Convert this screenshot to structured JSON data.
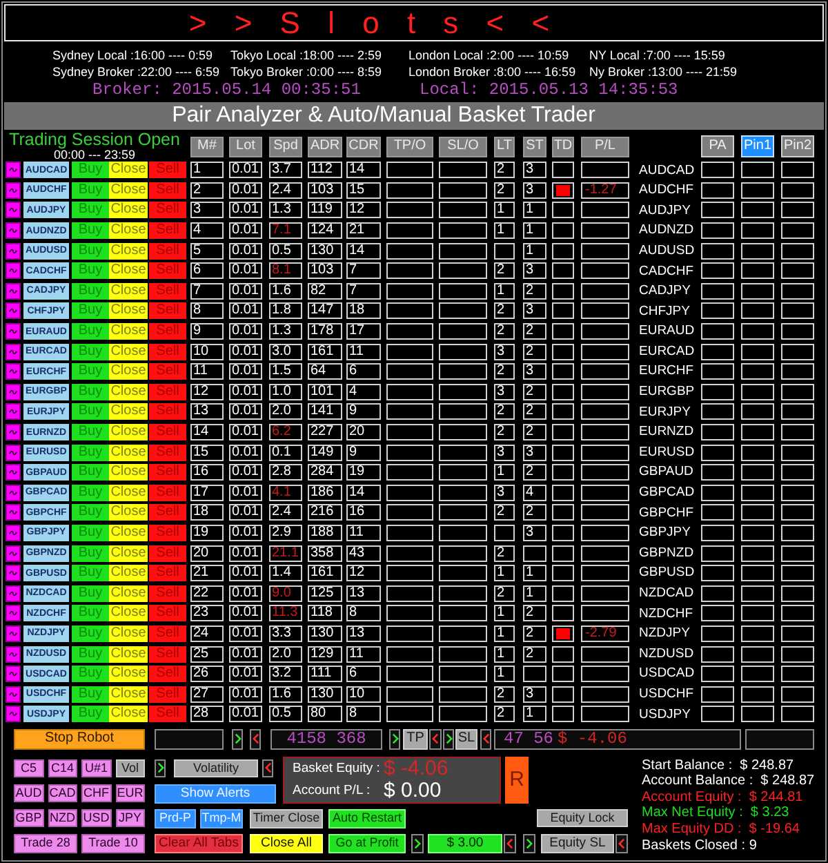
{
  "title": "> > S l o t s < <",
  "sessions": [
    {
      "local": "Sydney Local :16:00 ---- 0:59",
      "broker": "Sydney Broker :22:00 ---- 6:59"
    },
    {
      "local": "Tokyo Local :18:00 ---- 2:59",
      "broker": "Tokyo Broker :0:00 ---- 8:59"
    },
    {
      "local": "London Local :2:00 ---- 10:59",
      "broker": "London Broker :8:00 ---- 16:59"
    },
    {
      "local": "NY Local :7:00 ---- 15:59",
      "broker": "Ny Broker :13:00 ---- 21:59"
    }
  ],
  "clocks": {
    "broker": "Broker: 2015.05.14 00:35:51",
    "local": "Local: 2015.05.13 14:35:53"
  },
  "panel_title": "Pair Analyzer & Auto/Manual Basket Trader",
  "session_status": {
    "label": "Trading Session Open",
    "hours": "00:00 --- 23:59"
  },
  "table": {
    "columns": [
      "M#",
      "Lot",
      "Spd",
      "ADR",
      "CDR",
      "TP/O",
      "SL/O",
      "LT",
      "ST",
      "TD",
      "P/L"
    ],
    "pins": [
      {
        "label": "PA",
        "selected": false
      },
      {
        "label": "Pin1",
        "selected": true
      },
      {
        "label": "Pin2",
        "selected": false
      }
    ],
    "rows": [
      {
        "pair": "AUDCAD",
        "buy": "Buy",
        "close": "Close",
        "sell": "Sell",
        "num": "1",
        "lot": "0.01",
        "spread": "3.7",
        "spread_high": false,
        "adr": "112",
        "cdr": "14",
        "lt": "2",
        "st": "3",
        "trade_open": false,
        "name": "AUDCAD"
      },
      {
        "pair": "AUDCHF",
        "buy": "Buy",
        "close": "Close",
        "sell": "Sell",
        "num": "2",
        "lot": "0.01",
        "spread": "2.4",
        "spread_high": false,
        "adr": "103",
        "cdr": "15",
        "lt": "2",
        "st": "3",
        "trade_open": true,
        "pl": "-1.27",
        "name": "AUDCHF"
      },
      {
        "pair": "AUDJPY",
        "buy": "Buy",
        "close": "Close",
        "sell": "Sell",
        "num": "3",
        "lot": "0.01",
        "spread": "1.3",
        "spread_high": false,
        "adr": "119",
        "cdr": "12",
        "lt": "1",
        "st": "1",
        "trade_open": false,
        "name": "AUDJPY"
      },
      {
        "pair": "AUDNZD",
        "buy": "Buy",
        "close": "Close",
        "sell": "Sell",
        "num": "4",
        "lot": "0.01",
        "spread": "7.1",
        "spread_high": true,
        "adr": "124",
        "cdr": "21",
        "lt": "1",
        "st": "1",
        "trade_open": false,
        "name": "AUDNZD"
      },
      {
        "pair": "AUDUSD",
        "buy": "Buy",
        "close": "Close",
        "sell": "Sell",
        "num": "5",
        "lot": "0.01",
        "spread": "0.5",
        "spread_high": false,
        "adr": "130",
        "cdr": "14",
        "st": "1",
        "trade_open": false,
        "name": "AUDUSD"
      },
      {
        "pair": "CADCHF",
        "buy": "Buy",
        "close": "Close",
        "sell": "Sell",
        "num": "6",
        "lot": "0.01",
        "spread": "8.1",
        "spread_high": true,
        "adr": "103",
        "cdr": "7",
        "lt": "2",
        "st": "3",
        "trade_open": false,
        "name": "CADCHF"
      },
      {
        "pair": "CADJPY",
        "buy": "Buy",
        "close": "Close",
        "sell": "Sell",
        "num": "7",
        "lot": "0.01",
        "spread": "1.6",
        "spread_high": false,
        "adr": "82",
        "cdr": "7",
        "lt": "1",
        "st": "2",
        "trade_open": false,
        "name": "CADJPY"
      },
      {
        "pair": "CHFJPY",
        "buy": "Buy",
        "close": "Close",
        "sell": "Sell",
        "num": "8",
        "lot": "0.01",
        "spread": "1.8",
        "spread_high": false,
        "adr": "147",
        "cdr": "18",
        "lt": "2",
        "st": "3",
        "trade_open": false,
        "name": "CHFJPY"
      },
      {
        "pair": "EURAUD",
        "buy": "Buy",
        "close": "Close",
        "sell": "Sell",
        "num": "9",
        "lot": "0.01",
        "spread": "1.3",
        "spread_high": false,
        "adr": "178",
        "cdr": "17",
        "lt": "2",
        "st": "2",
        "trade_open": false,
        "name": "EURAUD"
      },
      {
        "pair": "EURCAD",
        "buy": "Buy",
        "close": "Close",
        "sell": "Sell",
        "num": "10",
        "lot": "0.01",
        "spread": "3.0",
        "spread_high": false,
        "adr": "161",
        "cdr": "11",
        "lt": "3",
        "st": "2",
        "trade_open": false,
        "name": "EURCAD"
      },
      {
        "pair": "EURCHF",
        "buy": "Buy",
        "close": "Close",
        "sell": "Sell",
        "num": "11",
        "lot": "0.01",
        "spread": "1.5",
        "spread_high": false,
        "adr": "64",
        "cdr": "6",
        "lt": "2",
        "st": "3",
        "trade_open": false,
        "name": "EURCHF"
      },
      {
        "pair": "EURGBP",
        "buy": "Buy",
        "close": "Close",
        "sell": "Sell",
        "num": "12",
        "lot": "0.01",
        "spread": "1.0",
        "spread_high": false,
        "adr": "101",
        "cdr": "4",
        "lt": "3",
        "st": "2",
        "trade_open": false,
        "name": "EURGBP"
      },
      {
        "pair": "EURJPY",
        "buy": "Buy",
        "close": "Close",
        "sell": "Sell",
        "num": "13",
        "lot": "0.01",
        "spread": "2.0",
        "spread_high": false,
        "adr": "141",
        "cdr": "9",
        "lt": "2",
        "st": "2",
        "trade_open": false,
        "name": "EURJPY"
      },
      {
        "pair": "EURNZD",
        "buy": "Buy",
        "close": "Close",
        "sell": "Sell",
        "num": "14",
        "lot": "0.01",
        "spread": "6.2",
        "spread_high": true,
        "adr": "227",
        "cdr": "20",
        "lt": "2",
        "st": "2",
        "trade_open": false,
        "name": "EURNZD"
      },
      {
        "pair": "EURUSD",
        "buy": "Buy",
        "close": "Close",
        "sell": "Sell",
        "num": "15",
        "lot": "0.01",
        "spread": "0.1",
        "spread_high": false,
        "adr": "149",
        "cdr": "9",
        "lt": "3",
        "st": "3",
        "trade_open": false,
        "name": "EURUSD"
      },
      {
        "pair": "GBPAUD",
        "buy": "Buy",
        "close": "Close",
        "sell": "Sell",
        "num": "16",
        "lot": "0.01",
        "spread": "2.8",
        "spread_high": false,
        "adr": "284",
        "cdr": "19",
        "lt": "1",
        "st": "2",
        "trade_open": false,
        "name": "GBPAUD"
      },
      {
        "pair": "GBPCAD",
        "buy": "Buy",
        "close": "Close",
        "sell": "Sell",
        "num": "17",
        "lot": "0.01",
        "spread": "4.1",
        "spread_high": true,
        "adr": "186",
        "cdr": "14",
        "lt": "3",
        "st": "4",
        "trade_open": false,
        "name": "GBPCAD"
      },
      {
        "pair": "GBPCHF",
        "buy": "Buy",
        "close": "Close",
        "sell": "Sell",
        "num": "18",
        "lot": "0.01",
        "spread": "2.4",
        "spread_high": false,
        "adr": "216",
        "cdr": "16",
        "lt": "2",
        "st": "2",
        "trade_open": false,
        "name": "GBPCHF"
      },
      {
        "pair": "GBPJPY",
        "buy": "Buy",
        "close": "Close",
        "sell": "Sell",
        "num": "19",
        "lot": "0.01",
        "spread": "2.9",
        "spread_high": false,
        "adr": "188",
        "cdr": "11",
        "st": "3",
        "trade_open": false,
        "name": "GBPJPY"
      },
      {
        "pair": "GBPNZD",
        "buy": "Buy",
        "close": "Close",
        "sell": "Sell",
        "num": "20",
        "lot": "0.01",
        "spread": "21.1",
        "spread_high": true,
        "adr": "358",
        "cdr": "43",
        "lt": "2",
        "trade_open": false,
        "name": "GBPNZD"
      },
      {
        "pair": "GBPUSD",
        "buy": "Buy",
        "close": "Close",
        "sell": "Sell",
        "num": "21",
        "lot": "0.01",
        "spread": "1.4",
        "spread_high": false,
        "adr": "161",
        "cdr": "12",
        "lt": "1",
        "st": "1",
        "trade_open": false,
        "name": "GBPUSD"
      },
      {
        "pair": "NZDCAD",
        "buy": "Buy",
        "close": "Close",
        "sell": "Sell",
        "num": "22",
        "lot": "0.01",
        "spread": "9.0",
        "spread_high": true,
        "adr": "125",
        "cdr": "13",
        "lt": "2",
        "st": "1",
        "trade_open": false,
        "name": "NZDCAD"
      },
      {
        "pair": "NZDCHF",
        "buy": "Buy",
        "close": "Close",
        "sell": "Sell",
        "num": "23",
        "lot": "0.01",
        "spread": "11.3",
        "spread_high": true,
        "adr": "118",
        "cdr": "8",
        "lt": "1",
        "st": "2",
        "trade_open": false,
        "name": "NZDCHF"
      },
      {
        "pair": "NZDJPY",
        "buy": "Buy",
        "close": "Close",
        "sell": "Sell",
        "num": "24",
        "lot": "0.01",
        "spread": "3.3",
        "spread_high": false,
        "adr": "130",
        "cdr": "13",
        "lt": "1",
        "st": "2",
        "trade_open": true,
        "pl": "-2.79",
        "name": "NZDJPY"
      },
      {
        "pair": "NZDUSD",
        "buy": "Buy",
        "close": "Close",
        "sell": "Sell",
        "num": "25",
        "lot": "0.01",
        "spread": "2.0",
        "spread_high": false,
        "adr": "129",
        "cdr": "11",
        "lt": "1",
        "st": "2",
        "trade_open": false,
        "name": "NZDUSD"
      },
      {
        "pair": "USDCAD",
        "buy": "Buy",
        "close": "Close",
        "sell": "Sell",
        "num": "26",
        "lot": "0.01",
        "spread": "3.2",
        "spread_high": false,
        "adr": "111",
        "cdr": "6",
        "lt": "1",
        "trade_open": false,
        "name": "USDCAD"
      },
      {
        "pair": "USDCHF",
        "buy": "Buy",
        "close": "Close",
        "sell": "Sell",
        "num": "27",
        "lot": "0.01",
        "spread": "1.6",
        "spread_high": false,
        "adr": "130",
        "cdr": "10",
        "lt": "2",
        "st": "3",
        "trade_open": false,
        "name": "USDCHF"
      },
      {
        "pair": "USDJPY",
        "buy": "Buy",
        "close": "Close",
        "sell": "Sell",
        "num": "28",
        "lot": "0.01",
        "spread": "0.5",
        "spread_high": false,
        "adr": "80",
        "cdr": "8",
        "lt": "2",
        "st": "1",
        "trade_open": false,
        "name": "USDJPY"
      }
    ]
  },
  "controls": {
    "stop_robot": "Stop Robot",
    "counter": "4158 368",
    "tp": "TP",
    "sl": "SL",
    "readout": {
      "pips": "47 56",
      "amount": "$ -4.06"
    }
  },
  "filters": [
    {
      "label": "C5",
      "on": true
    },
    {
      "label": "C14",
      "on": true
    },
    {
      "label": "U#1",
      "on": true
    },
    {
      "label": "Vol",
      "on": false
    },
    {
      "label": "AUD",
      "on": true
    },
    {
      "label": "CAD",
      "on": true
    },
    {
      "label": "CHF",
      "on": true
    },
    {
      "label": "EUR",
      "on": true
    },
    {
      "label": "GBP",
      "on": true
    },
    {
      "label": "NZD",
      "on": true
    },
    {
      "label": "USD",
      "on": true
    },
    {
      "label": "JPY",
      "on": true
    }
  ],
  "trade_buttons": [
    "Trade 28",
    "Trade 10"
  ],
  "volatility": "Volatility",
  "show_alerts": "Show Alerts",
  "modes": [
    "Prd-P",
    "Tmp-M"
  ],
  "timer_close": {
    "label": "Timer Close",
    "on": false
  },
  "auto_restart": {
    "label": "Auto Restart",
    "on": true
  },
  "clear_all_tabs": "Clear All Tabs",
  "close_all": "Close All",
  "go_at_profit": "Go at Profit",
  "profit_target": "$ 3.00",
  "equity_sl": "Equity SL",
  "equity_lock": {
    "label": "Equity Lock",
    "on": false
  },
  "basket": {
    "equity_label": "Basket Equity :",
    "equity": "$ -4.06",
    "pl_label": "Account P/L :",
    "pl": "$ 0.00"
  },
  "reset": "R",
  "stats": [
    {
      "text": "Start Balance :  $ 248.87",
      "color": "#ffffff"
    },
    {
      "text": "Account Balance :  $ 248.87",
      "color": "#ffffff"
    },
    {
      "text": "Account Equity :  $ 244.81",
      "color": "#ff2020"
    },
    {
      "text": "Max Net Equity :  $ 3.23",
      "color": "#22dd22"
    },
    {
      "text": "Max Equity DD :  $ -19.64",
      "color": "#ff2020"
    },
    {
      "text": "Baskets Closed : 9",
      "color": "#ffffff"
    }
  ]
}
